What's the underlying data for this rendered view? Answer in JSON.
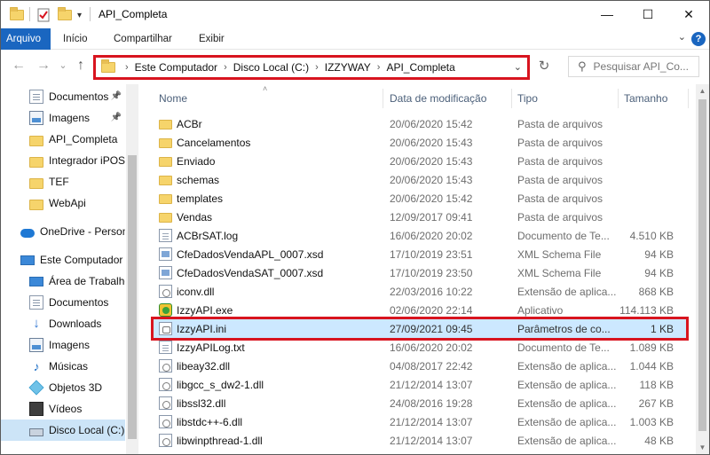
{
  "title": "API_Completa",
  "window_controls": {
    "minimize": "—",
    "maximize": "☐",
    "close": "✕"
  },
  "ribbon": {
    "tabs": [
      "Arquivo",
      "Início",
      "Compartilhar",
      "Exibir"
    ],
    "help": "?"
  },
  "nav": {
    "back": "←",
    "forward": "→",
    "recent": "⌄",
    "up": "↑",
    "breadcrumb": [
      "Este Computador",
      "Disco Local (C:)",
      "IZZYWAY",
      "API_Completa"
    ],
    "refresh": "↻",
    "search_placeholder": "Pesquisar API_Co..."
  },
  "sidebar": {
    "items": [
      {
        "label": "Documentos",
        "icon": "documents-icon",
        "pinned": true
      },
      {
        "label": "Imagens",
        "icon": "pictures-icon",
        "pinned": true
      },
      {
        "label": "API_Completa",
        "icon": "folder-icon"
      },
      {
        "label": "Integrador iPOS",
        "icon": "folder-icon"
      },
      {
        "label": "TEF",
        "icon": "folder-icon"
      },
      {
        "label": "WebApi",
        "icon": "folder-icon"
      },
      {
        "label": "OneDrive - Person",
        "icon": "onedrive-icon"
      },
      {
        "label": "Este Computador",
        "icon": "computer-icon"
      },
      {
        "label": "Área de Trabalho",
        "icon": "desktop-icon"
      },
      {
        "label": "Documentos",
        "icon": "documents-icon"
      },
      {
        "label": "Downloads",
        "icon": "downloads-icon"
      },
      {
        "label": "Imagens",
        "icon": "pictures-icon"
      },
      {
        "label": "Músicas",
        "icon": "music-icon"
      },
      {
        "label": "Objetos 3D",
        "icon": "objects3d-icon"
      },
      {
        "label": "Vídeos",
        "icon": "videos-icon"
      },
      {
        "label": "Disco Local (C:)",
        "icon": "drive-icon",
        "selected": true
      }
    ]
  },
  "columns": {
    "name": "Nome",
    "date": "Data de modificação",
    "type": "Tipo",
    "size": "Tamanho"
  },
  "files": [
    {
      "name": "ACBr",
      "date": "20/06/2020 15:42",
      "type": "Pasta de arquivos",
      "size": "",
      "kind": "folder"
    },
    {
      "name": "Cancelamentos",
      "date": "20/06/2020 15:43",
      "type": "Pasta de arquivos",
      "size": "",
      "kind": "folder"
    },
    {
      "name": "Enviado",
      "date": "20/06/2020 15:43",
      "type": "Pasta de arquivos",
      "size": "",
      "kind": "folder"
    },
    {
      "name": "schemas",
      "date": "20/06/2020 15:43",
      "type": "Pasta de arquivos",
      "size": "",
      "kind": "folder"
    },
    {
      "name": "templates",
      "date": "20/06/2020 15:42",
      "type": "Pasta de arquivos",
      "size": "",
      "kind": "folder"
    },
    {
      "name": "Vendas",
      "date": "12/09/2017 09:41",
      "type": "Pasta de arquivos",
      "size": "",
      "kind": "folder"
    },
    {
      "name": "ACBrSAT.log",
      "date": "16/06/2020 20:02",
      "type": "Documento de Te...",
      "size": "4.510 KB",
      "kind": "doc"
    },
    {
      "name": "CfeDadosVendaAPL_0007.xsd",
      "date": "17/10/2019 23:51",
      "type": "XML Schema File",
      "size": "94 KB",
      "kind": "xml"
    },
    {
      "name": "CfeDadosVendaSAT_0007.xsd",
      "date": "17/10/2019 23:50",
      "type": "XML Schema File",
      "size": "94 KB",
      "kind": "xml"
    },
    {
      "name": "iconv.dll",
      "date": "22/03/2016 10:22",
      "type": "Extensão de aplica...",
      "size": "868 KB",
      "kind": "dll"
    },
    {
      "name": "IzzyAPI.exe",
      "date": "02/06/2020 22:14",
      "type": "Aplicativo",
      "size": "114.113 KB",
      "kind": "exe"
    },
    {
      "name": "IzzyAPI.ini",
      "date": "27/09/2021 09:45",
      "type": "Parâmetros de co...",
      "size": "1 KB",
      "kind": "ini",
      "selected": true
    },
    {
      "name": "IzzyAPILog.txt",
      "date": "16/06/2020 20:02",
      "type": "Documento de Te...",
      "size": "1.089 KB",
      "kind": "doc"
    },
    {
      "name": "libeay32.dll",
      "date": "04/08/2017 22:42",
      "type": "Extensão de aplica...",
      "size": "1.044 KB",
      "kind": "dll"
    },
    {
      "name": "libgcc_s_dw2-1.dll",
      "date": "21/12/2014 13:07",
      "type": "Extensão de aplica...",
      "size": "118 KB",
      "kind": "dll"
    },
    {
      "name": "libssl32.dll",
      "date": "24/08/2016 19:28",
      "type": "Extensão de aplica...",
      "size": "267 KB",
      "kind": "dll"
    },
    {
      "name": "libstdc++-6.dll",
      "date": "21/12/2014 13:07",
      "type": "Extensão de aplica...",
      "size": "1.003 KB",
      "kind": "dll"
    },
    {
      "name": "libwinpthread-1.dll",
      "date": "21/12/2014 13:07",
      "type": "Extensão de aplica...",
      "size": "48 KB",
      "kind": "dll"
    }
  ],
  "colors": {
    "accent": "#1a66c0",
    "highlight": "#d8141f",
    "selection": "#cce8ff"
  }
}
